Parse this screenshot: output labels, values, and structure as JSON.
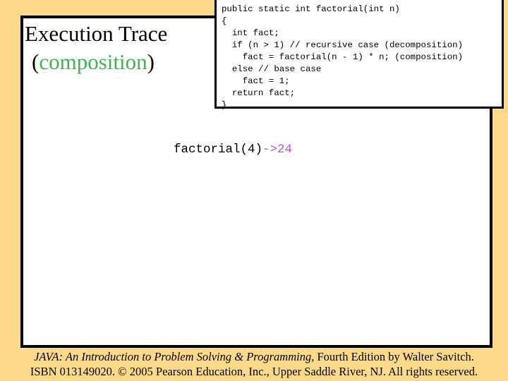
{
  "slide": {
    "title_line1": "Execution Trace",
    "title_paren_open": "(",
    "title_highlight": "composition",
    "title_paren_close": ")",
    "colors": {
      "background": "#FDD98A",
      "highlight_green": "#3CB54A",
      "result_magenta": "#C050C8"
    }
  },
  "code": {
    "lines": [
      "public static int factorial(int n)",
      "{",
      "  int fact;",
      "  if (n > 1) // recursive case (decomposition)",
      "    fact = factorial(n - 1) * n; (composition)",
      "  else // base case",
      "    fact = 1;",
      "  return fact;",
      "}"
    ]
  },
  "trace": {
    "call": "factorial(4)",
    "arrow_result": "->24"
  },
  "footer": {
    "book_title": "JAVA: An Introduction to Problem Solving & Programming",
    "edition_text": ", Fourth Edition by Walter Savitch.",
    "copyright": "ISBN 013149020. © 2005 Pearson Education, Inc., Upper Saddle River, NJ. All rights reserved."
  }
}
